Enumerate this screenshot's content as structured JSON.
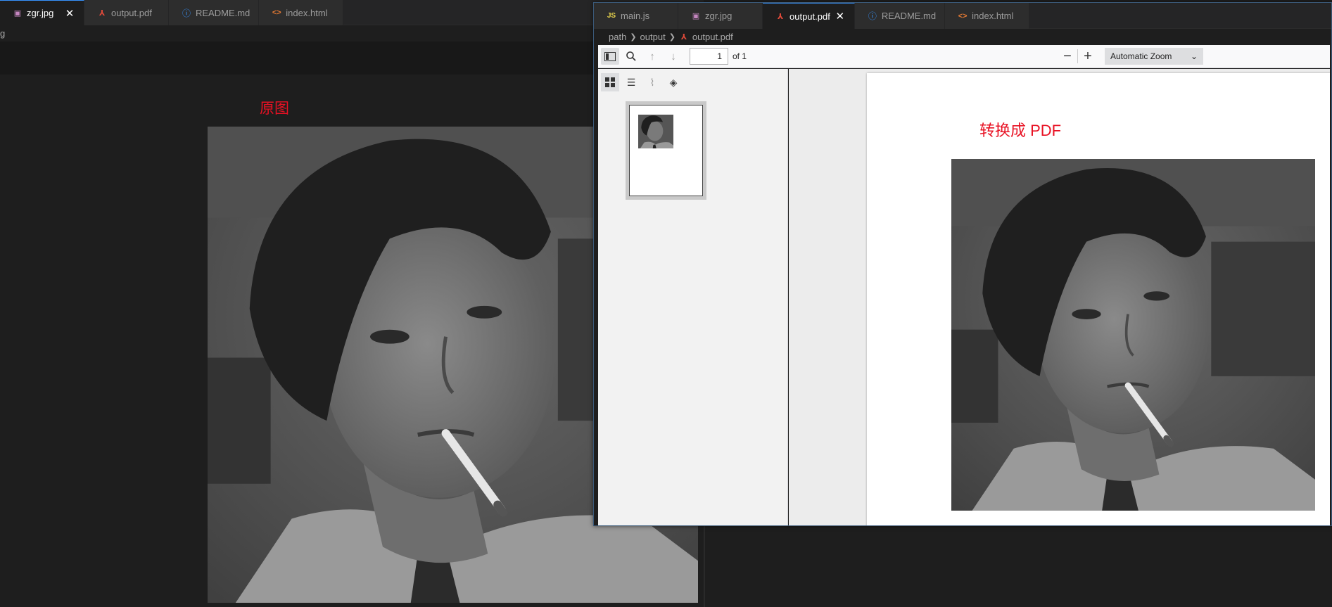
{
  "left": {
    "tabs": [
      {
        "icon": "image-icon",
        "label": "zgr.jpg",
        "active": true,
        "closable": true
      },
      {
        "icon": "pdf-icon",
        "label": "output.pdf",
        "active": false
      },
      {
        "icon": "info-icon",
        "label": "README.md",
        "active": false
      },
      {
        "icon": "html-icon",
        "label": "index.html",
        "active": false
      }
    ],
    "breadcrumb": "g",
    "caption": "原图"
  },
  "right": {
    "tabs": [
      {
        "icon": "js-icon",
        "label": "main.js",
        "active": false
      },
      {
        "icon": "image-icon",
        "label": "zgr.jpg",
        "active": false
      },
      {
        "icon": "pdf-icon",
        "label": "output.pdf",
        "active": true,
        "closable": true
      },
      {
        "icon": "info-icon",
        "label": "README.md",
        "active": false
      },
      {
        "icon": "html-icon",
        "label": "index.html",
        "active": false
      }
    ],
    "breadcrumb": [
      "path",
      "output",
      "output.pdf"
    ],
    "toolbar": {
      "page_value": "1",
      "page_of": "of 1",
      "zoom": "Automatic Zoom"
    },
    "pdf": {
      "caption": "转换成 PDF"
    }
  },
  "colors": {
    "accent": "#3794ff",
    "caption_red": "#e81123",
    "editor_bg": "#1e1e1e"
  }
}
